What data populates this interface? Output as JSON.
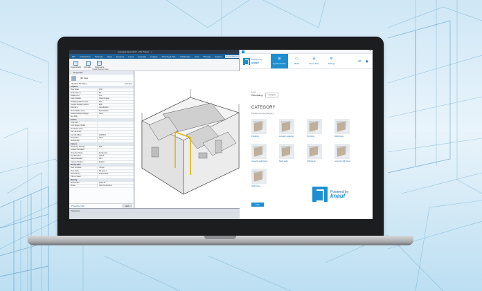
{
  "revit": {
    "window_title": "Autodesk Revit 2017 - [3D Projekt ...]",
    "tabs": [
      "File",
      "Architecture",
      "Structure",
      "Steel",
      "Systems",
      "Insert",
      "Annotate",
      "Analyze",
      "Massing & Site",
      "Collaborate",
      "View",
      "Manage",
      "Add-Ins",
      "Knauf Planner Suite"
    ],
    "active_tab": "Knauf Planner Suite",
    "ribbon_buttons": [
      "Systemfinder",
      "Schnellpr.",
      "Dokumente"
    ],
    "ribbon_panel": "Knauf Planner Suite",
    "properties_title": "Properties",
    "type_name": "3D View",
    "selector_value": "3D View: 3D View 1",
    "edit_type": "Edit Type",
    "rows": [
      {
        "k": "Graphics",
        "v": "",
        "grp": true
      },
      {
        "k": "View Scale",
        "v": "1:50"
      },
      {
        "k": "Scale Value 1:",
        "v": "50"
      },
      {
        "k": "Detail Level",
        "v": "Fine"
      },
      {
        "k": "Parts Visibility",
        "v": "Show Original"
      },
      {
        "k": "Visibility/Graphics Overr...",
        "v": "Edit..."
      },
      {
        "k": "Graphic Display Options",
        "v": "Edit..."
      },
      {
        "k": "Discipline",
        "v": "Coordination"
      },
      {
        "k": "Show Hidden Lines",
        "v": "By Discipline"
      },
      {
        "k": "Default Analysis Display...",
        "v": "None"
      },
      {
        "k": "Sun Path",
        "v": ""
      },
      {
        "k": "Extents",
        "v": "",
        "grp": true
      },
      {
        "k": "Crop View",
        "v": ""
      },
      {
        "k": "Crop Region Visible",
        "v": ""
      },
      {
        "k": "Annotation Crop",
        "v": ""
      },
      {
        "k": "Far Clip Active",
        "v": ""
      },
      {
        "k": "Far Clip Offset",
        "v": "304800.0"
      },
      {
        "k": "Scope Box",
        "v": "None"
      },
      {
        "k": "Section Box",
        "v": ""
      },
      {
        "k": "Camera",
        "v": "",
        "grp": true
      },
      {
        "k": "Rendering Settings",
        "v": "Edit..."
      },
      {
        "k": "Locked Orientation",
        "v": ""
      },
      {
        "k": "Projection Mode",
        "v": "Perspective"
      },
      {
        "k": "Eye Elevation",
        "v": "7660.8"
      },
      {
        "k": "Target Elevation",
        "v": "98.4"
      },
      {
        "k": "Camera Position",
        "v": "Explicit"
      },
      {
        "k": "Identity Data",
        "v": "",
        "grp": true
      },
      {
        "k": "View Template",
        "v": "<None>"
      },
      {
        "k": "View Name",
        "v": "3D View 1"
      },
      {
        "k": "Dependency",
        "v": "Independent"
      },
      {
        "k": "Title on Sheet",
        "v": ""
      },
      {
        "k": "Phasing",
        "v": "",
        "grp": true
      },
      {
        "k": "Phase Filter",
        "v": "Show All"
      },
      {
        "k": "Phase",
        "v": "New Construction"
      }
    ],
    "properties_help": "Properties help",
    "apply": "Apply",
    "status_text": "Perspective"
  },
  "knauf": {
    "logo_small_top": "Powered by",
    "logo_small_brand": "knauf",
    "nav": [
      {
        "label": "System-Finder",
        "icon": "⊞",
        "active": true
      },
      {
        "label": "Model",
        "icon": "▭",
        "active": false
      },
      {
        "label": "Check Data",
        "icon": "☰",
        "active": false
      },
      {
        "label": "Settings",
        "icon": "⚙",
        "active": false
      }
    ],
    "mail_icon": "✉",
    "user_icon": "◉",
    "filter_label": "Land",
    "filter_value": "Germany",
    "filter_chip": "Category",
    "category_heading": "CATEGORY",
    "category_sub": "Please choose category",
    "cards": [
      "Partitions",
      "Acoustic solutions",
      "Dry lining",
      "Wall linings",
      "Acoustic wall linings",
      "Shaft walls",
      "Infill linings",
      "Acoustic infill linings",
      "Wall linings"
    ],
    "back_label": "back",
    "powered_by": "Powered by",
    "brand": "knauf"
  }
}
